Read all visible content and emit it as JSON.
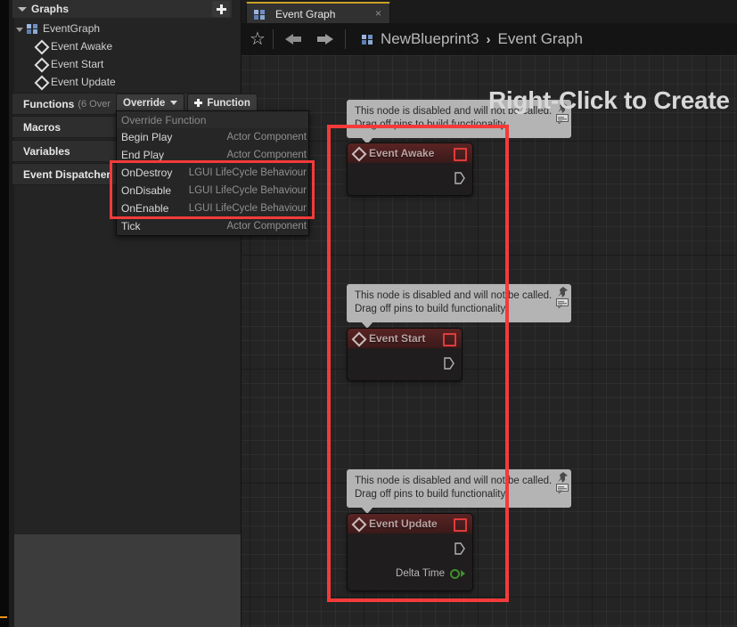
{
  "window": {
    "accent_color": "#c9a227",
    "annotation_color": "#f43a3a",
    "canvas_watermark": "Right-Click to Create"
  },
  "sidebar": {
    "graphs_header": {
      "title": "Graphs",
      "add_button_label": "+"
    },
    "tree": {
      "root": {
        "label": "EventGraph",
        "icon": "graph-icon"
      },
      "children": [
        {
          "label": "Event Awake",
          "icon": "event-diamond-icon"
        },
        {
          "label": "Event Start",
          "icon": "event-diamond-icon"
        },
        {
          "label": "Event Update",
          "icon": "event-diamond-icon"
        }
      ]
    },
    "categories": [
      {
        "label": "Functions",
        "sub": "(6 Over"
      },
      {
        "label": "Macros",
        "sub": ""
      },
      {
        "label": "Variables",
        "sub": ""
      },
      {
        "label": "Event Dispatcher",
        "sub": ""
      }
    ],
    "buttons": {
      "override": {
        "label": "Override",
        "icon": "chevron-down-icon"
      },
      "function": {
        "label": "Function",
        "icon": "plus-icon"
      }
    }
  },
  "override_dropdown": {
    "header": "Override Function",
    "items": [
      {
        "name": "Begin Play",
        "source": "Actor Component",
        "highlighted": false
      },
      {
        "name": "End Play",
        "source": "Actor Component",
        "highlighted": false
      },
      {
        "name": "OnDestroy",
        "source": "LGUI LifeCycle Behaviour",
        "highlighted": true
      },
      {
        "name": "OnDisable",
        "source": "LGUI LifeCycle Behaviour",
        "highlighted": true
      },
      {
        "name": "OnEnable",
        "source": "LGUI LifeCycle Behaviour",
        "highlighted": true
      },
      {
        "name": "Tick",
        "source": "Actor Component",
        "highlighted": false
      }
    ]
  },
  "tabbar": {
    "tabs": [
      {
        "label": "Event Graph",
        "icon": "graph-icon",
        "close_label": "×",
        "active": true
      }
    ]
  },
  "toolbar": {
    "favorite_icon": "star-icon",
    "back_icon": "arrow-left-icon",
    "forward_icon": "arrow-right-icon",
    "breadcrumb": {
      "icon": "graph-icon",
      "blueprint": "NewBlueprint3",
      "separator": "›",
      "graph": "Event Graph"
    }
  },
  "graph": {
    "tooltip_text_line1": "This node is disabled and will not be called.",
    "tooltip_text_line2": "Drag off pins to build functionality.",
    "tooltip_pin_icon": "pin-icon",
    "tooltip_comment_icon": "comment-icon",
    "nodes": [
      {
        "title": "Event Awake",
        "icon": "event-diamond-icon",
        "disabled_badge": "disabled-indicator",
        "exec_out_pin": "exec-output-pin",
        "data_pins": []
      },
      {
        "title": "Event Start",
        "icon": "event-diamond-icon",
        "disabled_badge": "disabled-indicator",
        "exec_out_pin": "exec-output-pin",
        "data_pins": []
      },
      {
        "title": "Event Update",
        "icon": "event-diamond-icon",
        "disabled_badge": "disabled-indicator",
        "exec_out_pin": "exec-output-pin",
        "data_pins": [
          {
            "label": "Delta Time",
            "type_color": "#3f8f2e"
          }
        ]
      }
    ]
  }
}
